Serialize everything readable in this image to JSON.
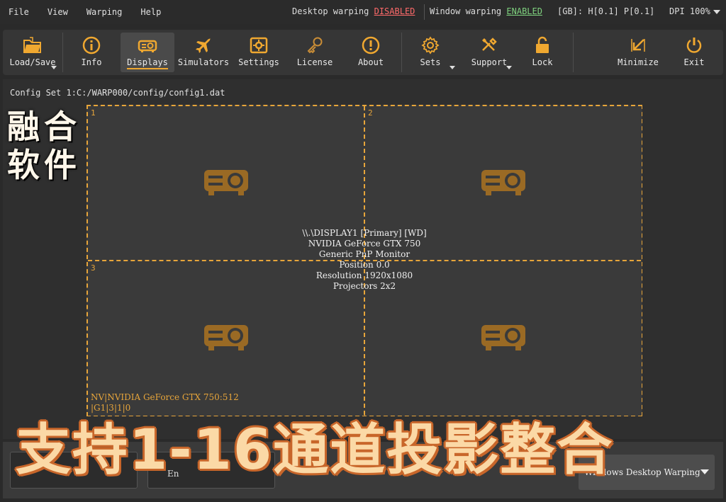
{
  "menu": {
    "items": [
      "File",
      "View",
      "Warping",
      "Help"
    ]
  },
  "status": {
    "desktop_label": "Desktop warping",
    "desktop_value": "DISABLED",
    "window_label": "Window warping",
    "window_value": "ENABLED",
    "gb_text": "[GB]: H[0.1] P[0.1]",
    "dpi_text": "DPI 100%"
  },
  "toolbar": {
    "load_save": "Load/Save",
    "info": "Info",
    "displays": "Displays",
    "simulators": "Simulators",
    "settings": "Settings",
    "license": "License",
    "about": "About",
    "sets": "Sets",
    "support": "Support",
    "lock": "Lock",
    "minimize": "Minimize",
    "exit": "Exit"
  },
  "main": {
    "config_path": "Config Set 1:C:/WARP000/config/config1.dat",
    "side_title_line1": "融合",
    "side_title_line2": "软件",
    "cells": [
      "1",
      "2",
      "3"
    ],
    "info_lines": [
      "\\\\.\\DISPLAY1 [Primary] [WD]",
      "NVIDIA GeForce GTX 750",
      "Generic PnP Monitor",
      "Position 0.0",
      "Resolution 1920x1080",
      "Projectors 2x2"
    ],
    "gpu_line1": "NV|NVIDIA GeForce GTX 750:512",
    "gpu_line2": "|G1|3|1|0"
  },
  "bottom": {
    "partial_text": "En",
    "warp_mode_select": "Windows Desktop Warping"
  },
  "banner": {
    "text": "支持1-16通道投影整合"
  },
  "colors": {
    "accent": "#e7a53a",
    "disabled": "#ff6a6a",
    "enabled": "#7fd27f",
    "projector_icon": "#9a6a24"
  },
  "icons": {
    "load_save": "folder-icon",
    "info": "info-icon",
    "displays": "projector-icon",
    "simulators": "airplane-icon",
    "settings": "settings-panel-icon",
    "license": "key-icon",
    "about": "alert-circle-icon",
    "sets": "gear-icon",
    "support": "tools-icon",
    "lock": "unlock-icon",
    "minimize": "minimize-arrow-icon",
    "exit": "power-icon"
  }
}
